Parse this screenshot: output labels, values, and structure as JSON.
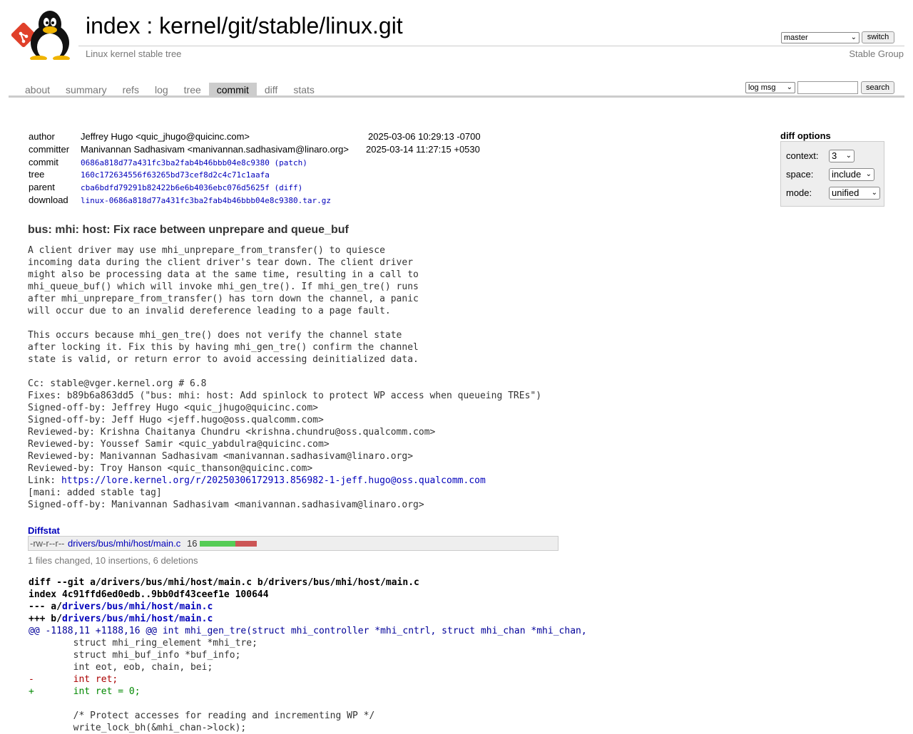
{
  "header": {
    "title_index": "index",
    "title_sep": " : ",
    "title_repo": "kernel/git/stable/linux.git",
    "subtitle": "Linux kernel stable tree",
    "branch": "master",
    "switch_label": "switch",
    "owner": "Stable Group"
  },
  "tabs": [
    {
      "label": "about"
    },
    {
      "label": "summary"
    },
    {
      "label": "refs"
    },
    {
      "label": "log"
    },
    {
      "label": "tree"
    },
    {
      "label": "commit",
      "active": true
    },
    {
      "label": "diff"
    },
    {
      "label": "stats"
    }
  ],
  "search": {
    "mode": "log msg",
    "query": "",
    "button": "search"
  },
  "commit_info": {
    "author_label": "author",
    "author": "Jeffrey Hugo <quic_jhugo@quicinc.com>",
    "author_date": "2025-03-06 10:29:13 -0700",
    "committer_label": "committer",
    "committer": "Manivannan Sadhasivam <manivannan.sadhasivam@linaro.org>",
    "committer_date": "2025-03-14 11:27:15 +0530",
    "commit_label": "commit",
    "commit": "0686a818d77a431fc3ba2fab4b46bbb04e8c9380",
    "commit_link": "(patch)",
    "tree_label": "tree",
    "tree": "160c172634556f63265bd73cef8d2c4c71c1aafa",
    "parent_label": "parent",
    "parent": "cba6bdfd79291b82422b6e6b4036ebc076d5625f",
    "parent_link": "(diff)",
    "download_label": "download",
    "download": "linux-0686a818d77a431fc3ba2fab4b46bbb04e8c9380.tar.gz"
  },
  "diff_options": {
    "title": "diff options",
    "context_label": "context:",
    "context_value": "3",
    "space_label": "space:",
    "space_value": "include",
    "mode_label": "mode:",
    "mode_value": "unified"
  },
  "message": {
    "subject": "bus: mhi: host: Fix race between unprepare and queue_buf",
    "body": "A client driver may use mhi_unprepare_from_transfer() to quiesce\nincoming data during the client driver's tear down. The client driver\nmight also be processing data at the same time, resulting in a call to\nmhi_queue_buf() which will invoke mhi_gen_tre(). If mhi_gen_tre() runs\nafter mhi_unprepare_from_transfer() has torn down the channel, a panic\nwill occur due to an invalid dereference leading to a page fault.\n\nThis occurs because mhi_gen_tre() does not verify the channel state\nafter locking it. Fix this by having mhi_gen_tre() confirm the channel\nstate is valid, or return error to avoid accessing deinitialized data.\n\nCc: stable@vger.kernel.org # 6.8\nFixes: b89b6a863dd5 (\"bus: mhi: host: Add spinlock to protect WP access when queueing TREs\")\nSigned-off-by: Jeffrey Hugo <quic_jhugo@quicinc.com>\nSigned-off-by: Jeff Hugo <jeff.hugo@oss.qualcomm.com>\nReviewed-by: Krishna Chaitanya Chundru <krishna.chundru@oss.qualcomm.com>\nReviewed-by: Youssef Samir <quic_yabdulra@quicinc.com>\nReviewed-by: Manivannan Sadhasivam <manivannan.sadhasivam@linaro.org>\nReviewed-by: Troy Hanson <quic_thanson@quicinc.com>",
    "link_prefix": "Link: ",
    "link": "https://lore.kernel.org/r/20250306172913.856982-1-jeff.hugo@oss.qualcomm.com",
    "tail": "[mani: added stable tag]\nSigned-off-by: Manivannan Sadhasivam <manivannan.sadhasivam@linaro.org>"
  },
  "diffstat": {
    "heading": "Diffstat",
    "mode": "-rw-r--r--",
    "file": "drivers/bus/mhi/host/main.c",
    "count": "16",
    "insertions": 10,
    "deletions": 6,
    "summary": "1 files changed, 10 insertions, 6 deletions",
    "add_color": "#55cc55",
    "del_color": "#cc5555"
  },
  "diff": {
    "git_line": "diff --git a/drivers/bus/mhi/host/main.c b/drivers/bus/mhi/host/main.c",
    "index_line": "index 4c91ffd6ed0edb..9bb0df43ceef1e 100644",
    "minus_prefix": "--- a/",
    "minus_file": "drivers/bus/mhi/host/main.c",
    "plus_prefix": "+++ b/",
    "plus_file": "drivers/bus/mhi/host/main.c",
    "hunk_range": "@@ -1188,11 +1188,16 @@",
    "hunk_context": " int mhi_gen_tre(struct mhi_controller *mhi_cntrl, struct mhi_chan *mhi_chan,",
    "lines": [
      {
        "type": "ctx",
        "text": " \tstruct mhi_ring_element *mhi_tre;"
      },
      {
        "type": "ctx",
        "text": " \tstruct mhi_buf_info *buf_info;"
      },
      {
        "type": "ctx",
        "text": " \tint eot, eob, chain, bei;"
      },
      {
        "type": "del",
        "text": "-\tint ret;"
      },
      {
        "type": "add",
        "text": "+\tint ret = 0;"
      },
      {
        "type": "ctx",
        "text": " "
      },
      {
        "type": "ctx",
        "text": " \t/* Protect accesses for reading and incrementing WP */"
      },
      {
        "type": "ctx",
        "text": " \twrite_lock_bh(&mhi_chan->lock);"
      }
    ]
  }
}
